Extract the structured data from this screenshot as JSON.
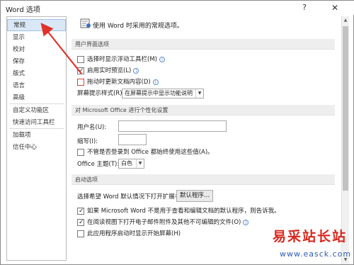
{
  "window": {
    "title": "Word 选项",
    "help_label": "?",
    "close_label": "✕"
  },
  "sidebar": {
    "items": [
      {
        "label": "常规"
      },
      {
        "label": "显示"
      },
      {
        "label": "校对"
      },
      {
        "label": "保存"
      },
      {
        "label": "版式"
      },
      {
        "label": "语言"
      },
      {
        "label": "高级"
      },
      {
        "label": "自定义功能区"
      },
      {
        "label": "快速访问工具栏"
      },
      {
        "label": "加载项"
      },
      {
        "label": "信任中心"
      }
    ]
  },
  "main": {
    "header": "使用 Word 时采用的常规选项。",
    "sections": {
      "ui": "用户界面选项",
      "personalize": "对 Microsoft Office 进行个性化设置",
      "startup": "启动选项"
    },
    "ui_options": {
      "mini_toolbar": "选择时显示浮动工具栏(M)",
      "live_preview": "启用实时预览(L)",
      "update_content": "拖动时更新文档内容(D)",
      "screentip_label": "屏幕提示样式(R):",
      "screentip_value": "在屏幕提示中显示功能说明"
    },
    "personalize": {
      "username_label": "用户名(U):",
      "username_value": "",
      "initials_label": "缩写(I):",
      "initials_value": "",
      "always_use_label": "不管是否登录到 Office 都始终使用这些值(A)。",
      "theme_label": "Office 主题(T):",
      "theme_value": "白色"
    },
    "startup": {
      "extensions_label": "选择希望 Word 默认情况下打开扩展名:",
      "default_programs_button": "默认程序...",
      "tell_me_label": "如果 Microsoft Word 不是用于查看和编辑文档的默认程序，则告诉我。",
      "open_email_label": "在阅读视图下打开电子邮件附件及其他不可编辑的文件(O)",
      "show_start_label": "此应用程序启动时显示开始屏幕(H)"
    }
  },
  "watermark": {
    "title": "易采站长站",
    "url": "www.easck.com"
  },
  "colors": {
    "annotation_arrow": "#e0312a",
    "selected_item_bg": "#d9e7f6",
    "section_bg": "#eeeeee"
  },
  "icons": {
    "header": "options-gear-icon",
    "info": "info-icon",
    "checkbox_checked": "check-icon"
  }
}
